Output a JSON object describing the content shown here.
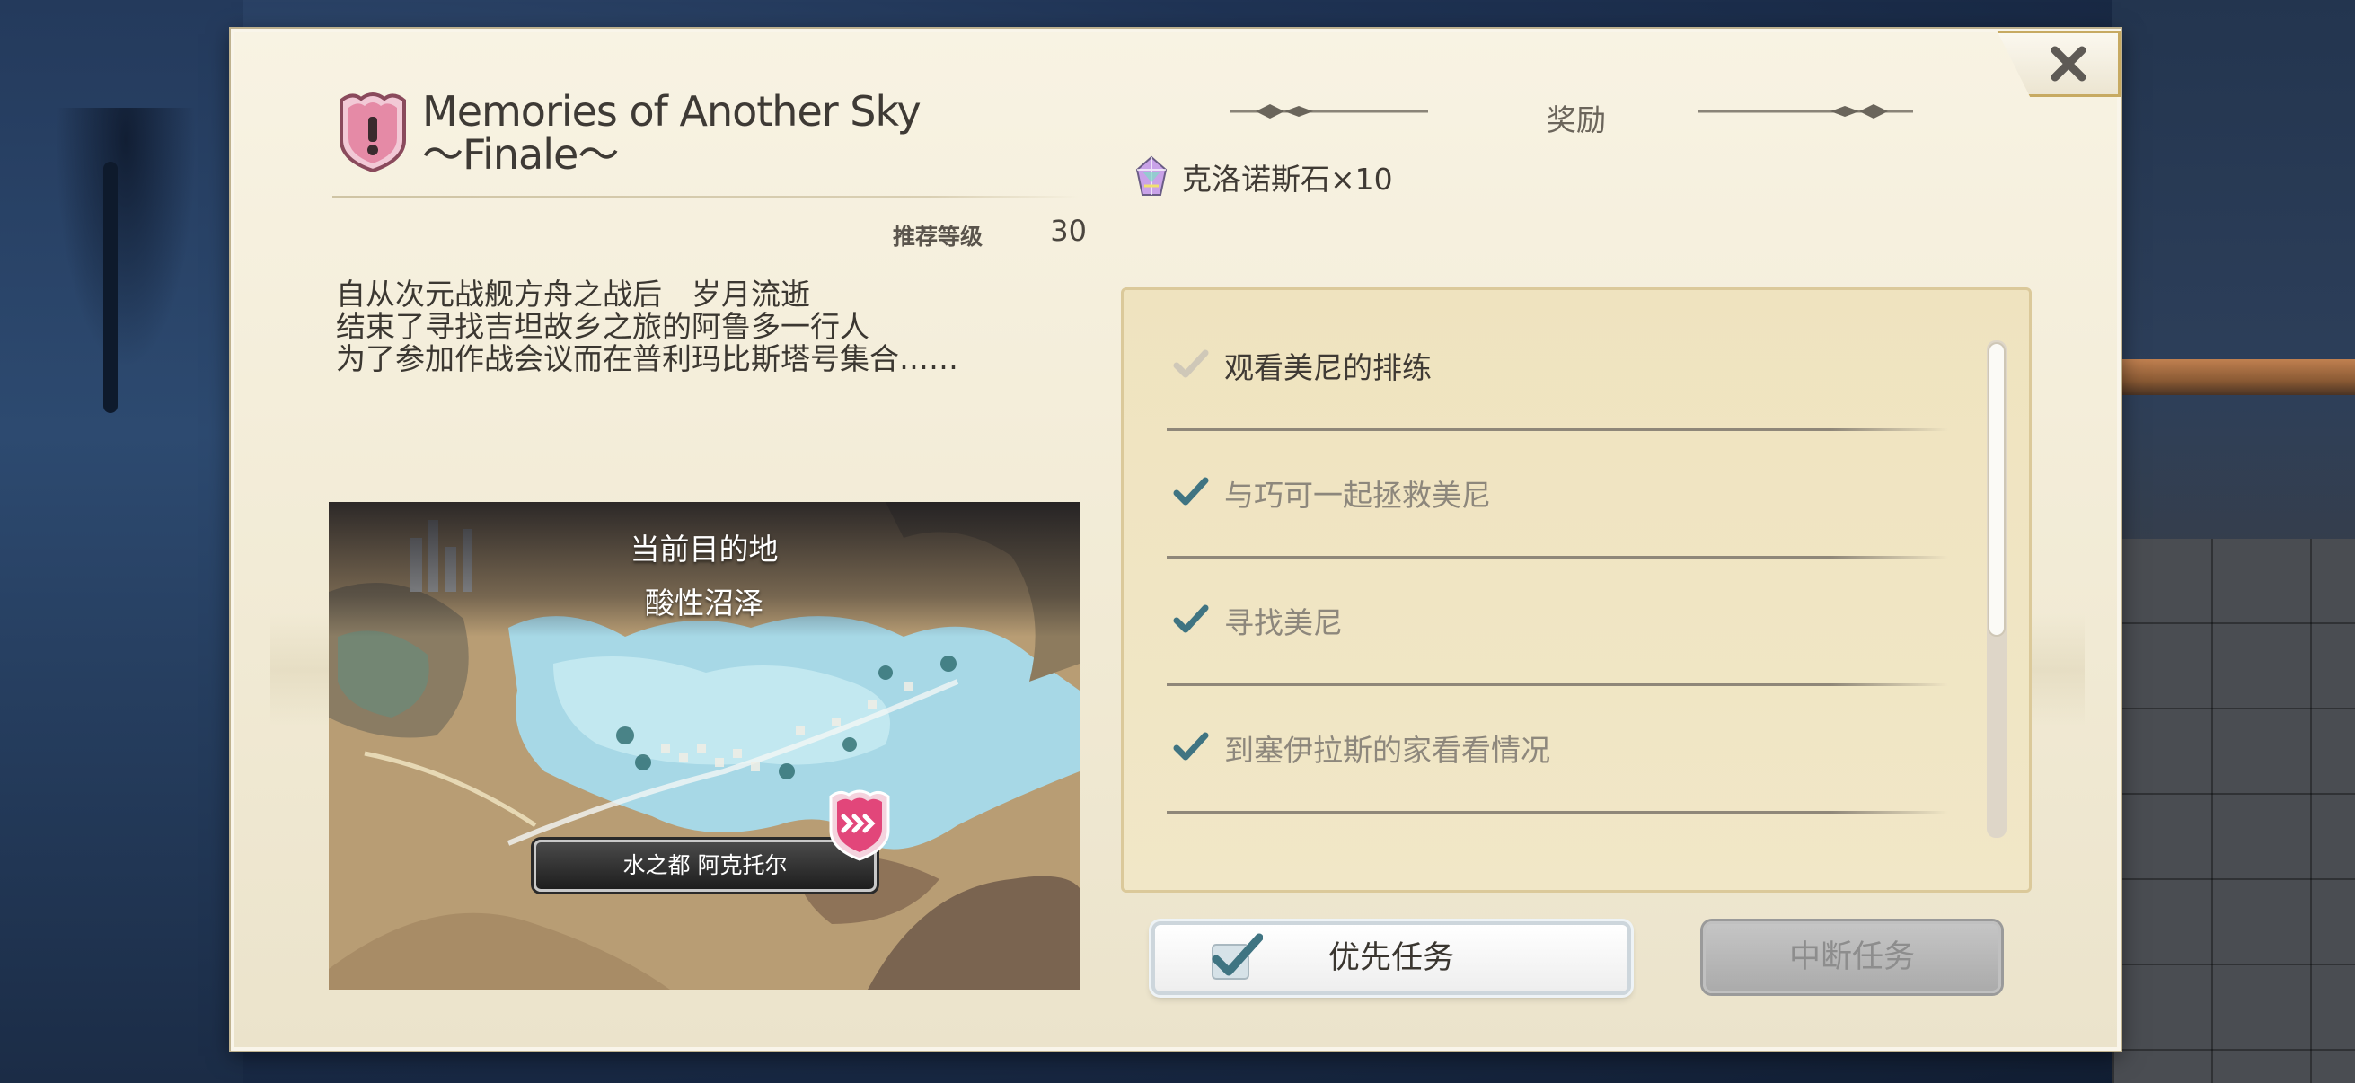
{
  "quest": {
    "title": "Memories of Another Sky\n〜Finale〜",
    "recommended_level_label": "推荐等级",
    "recommended_level": "30",
    "story": "自从次元战舰方舟之战后　岁月流逝\n结束了寻找吉坦故乡之旅的阿鲁多一行人\n为了参加作战会议而在普利玛比斯塔号集合……"
  },
  "map": {
    "destination_label": "当前目的地",
    "destination_name": "酸性沼泽",
    "current_location": "水之都 阿克托尔"
  },
  "reward": {
    "header": "奖励",
    "item_text": "克洛诺斯石×10",
    "item_icon": "chronos-stone-icon"
  },
  "tasks": [
    {
      "label": "观看美尼的排练",
      "status": "current"
    },
    {
      "label": "与巧可一起拯救美尼",
      "status": "done"
    },
    {
      "label": "寻找美尼",
      "status": "done"
    },
    {
      "label": "到塞伊拉斯的家看看情况",
      "status": "done"
    }
  ],
  "buttons": {
    "priority": "优先任务",
    "abort": "中断任务"
  },
  "colors": {
    "panel_bg": "#f1ead4",
    "check_done": "#3f7482",
    "check_current": "#cfc8b8",
    "quest_icon_pink": "#e58aa6",
    "gold_trim": "#c9a75c"
  }
}
